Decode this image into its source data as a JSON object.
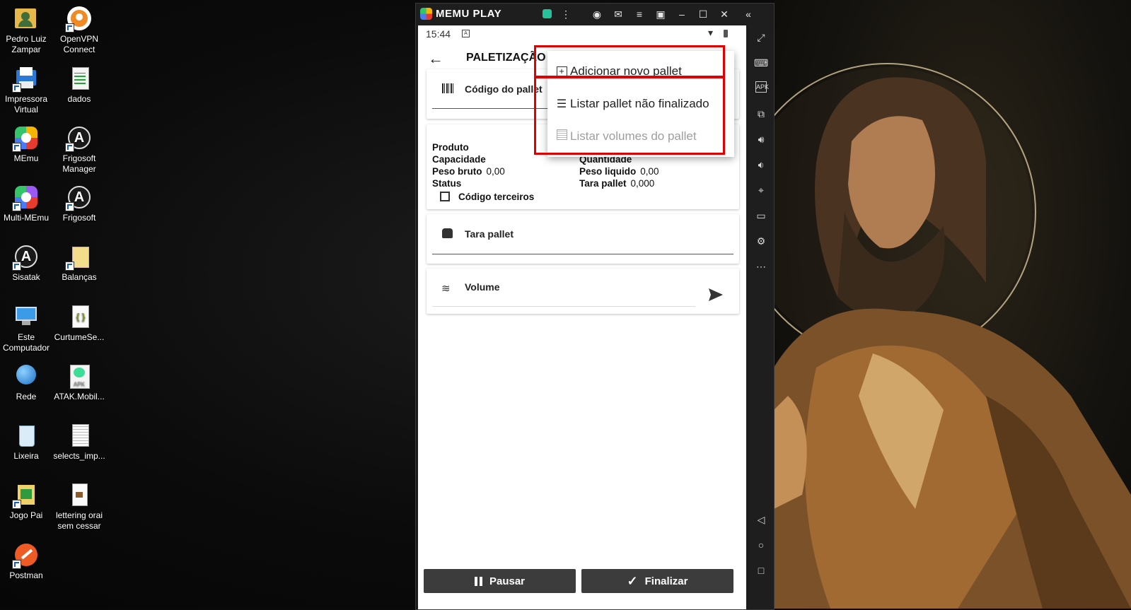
{
  "desktop": {
    "icons": [
      {
        "label": "Pedro Luiz Zampar",
        "icon": "user-folder-icon"
      },
      {
        "label": "OpenVPN Connect",
        "icon": "openvpn-icon"
      },
      {
        "label": "Impressora Virtual",
        "icon": "printer-icon"
      },
      {
        "label": "dados",
        "icon": "spreadsheet-icon"
      },
      {
        "label": "MEmu",
        "icon": "memu-icon"
      },
      {
        "label": "Frigosoft Manager",
        "icon": "frigosoft-icon"
      },
      {
        "label": "Multi-MEmu",
        "icon": "multi-memu-icon"
      },
      {
        "label": "Frigosoft",
        "icon": "frigosoft-icon"
      },
      {
        "label": "Sisatak",
        "icon": "sisatak-icon"
      },
      {
        "label": "Balanças",
        "icon": "folder-icon"
      },
      {
        "label": "Este Computador",
        "icon": "computer-icon"
      },
      {
        "label": "CurtumeSe...",
        "icon": "json-file-icon"
      },
      {
        "label": "Rede",
        "icon": "network-icon"
      },
      {
        "label": "ATAK.Mobil...",
        "icon": "apk-file-icon"
      },
      {
        "label": "Lixeira",
        "icon": "recycle-bin-icon"
      },
      {
        "label": "selects_imp...",
        "icon": "text-file-icon"
      },
      {
        "label": "Jogo Pai",
        "icon": "folder-icon"
      },
      {
        "label": "lettering orai sem cessar",
        "icon": "image-file-icon"
      },
      {
        "label": "Postman",
        "icon": "postman-icon"
      }
    ]
  },
  "emulator": {
    "title": "MEMU PLAY",
    "status_time": "15:44"
  },
  "app": {
    "title": "PALETIZAÇÃO",
    "codigo_label": "Código do pallet",
    "info": {
      "produto_label": "Produto",
      "capacidade_label": "Capacidade",
      "peso_bruto_label": "Peso bruto",
      "peso_bruto_value": "0,00",
      "status_label": "Status",
      "quantidade_label": "Quantidade",
      "peso_liquido_label": "Peso liquido",
      "peso_liquido_value": "0,00",
      "tara_pallet_label": "Tara pallet",
      "tara_pallet_value": "0,000",
      "codigo_terceiros_label": "Código terceiros"
    },
    "tara_label": "Tara pallet",
    "volume_label": "Volume",
    "pausar_label": "Pausar",
    "finalizar_label": "Finalizar"
  },
  "menu": {
    "items": [
      {
        "label": "Adicionar novo pallet",
        "enabled": true
      },
      {
        "label": "Listar pallet não finalizado",
        "enabled": true
      },
      {
        "label": "Listar volumes do pallet",
        "enabled": false
      }
    ],
    "highlight_color": "#e00000"
  }
}
